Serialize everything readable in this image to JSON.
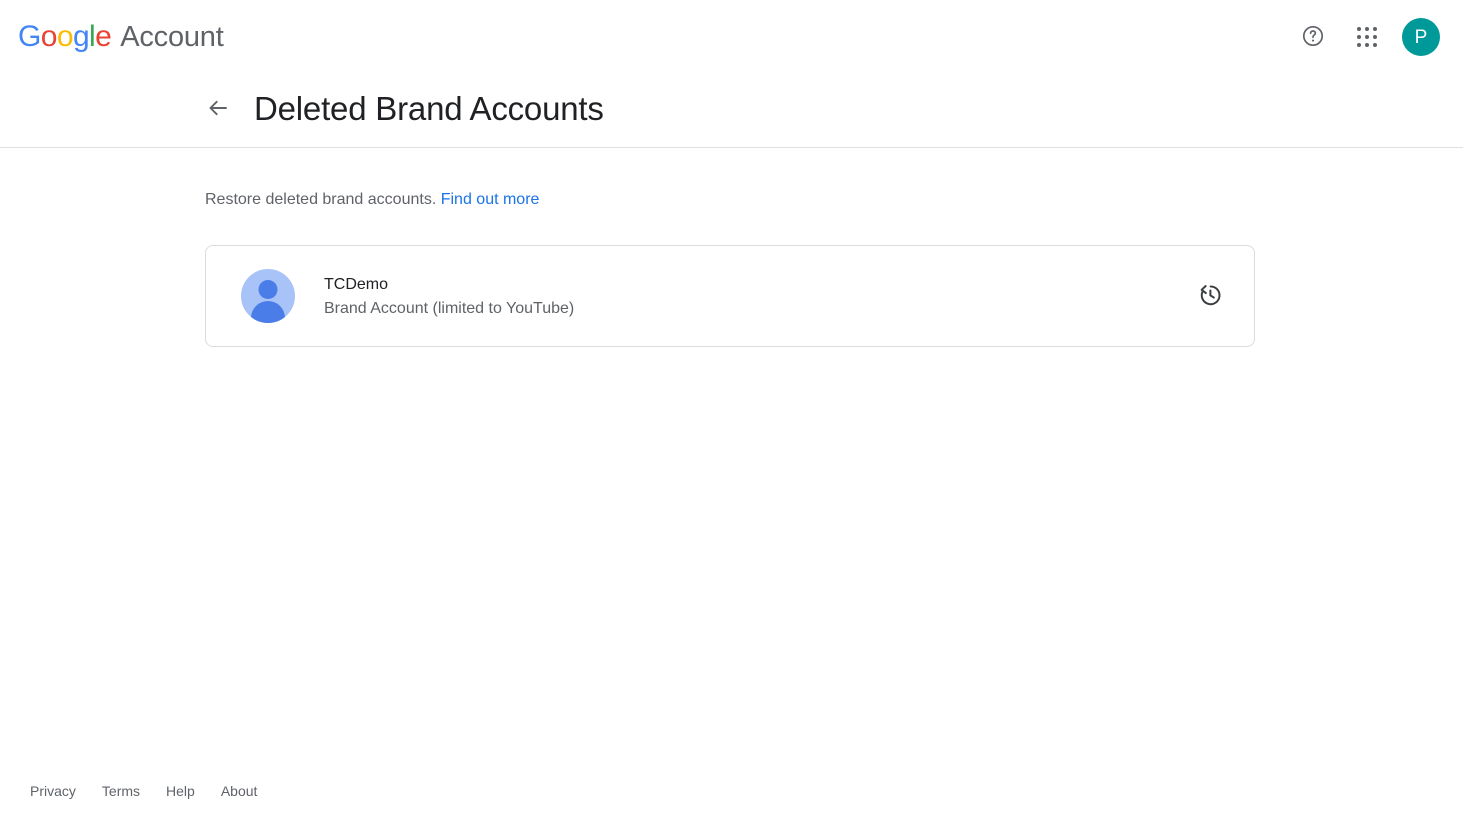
{
  "header": {
    "logo_letters": [
      "G",
      "o",
      "o",
      "g",
      "l",
      "e"
    ],
    "product_name": "Account",
    "help_icon": "help-circle-icon",
    "apps_icon": "apps-grid-icon",
    "avatar_initial": "P",
    "avatar_color": "#009999"
  },
  "title_bar": {
    "back_icon": "arrow-left-icon",
    "title": "Deleted Brand Accounts"
  },
  "main": {
    "description_text": "Restore deleted brand accounts.",
    "description_link": "Find out more",
    "accounts": [
      {
        "name": "TCDemo",
        "type": "Brand Account (limited to YouTube)",
        "avatar_icon": "default-person-avatar-icon",
        "restore_icon": "restore-history-icon"
      }
    ]
  },
  "footer": {
    "links": [
      "Privacy",
      "Terms",
      "Help",
      "About"
    ]
  },
  "colors": {
    "link_blue": "#1a73e8",
    "text_primary": "#202124",
    "text_secondary": "#5f6368",
    "border": "#dadce0",
    "divider": "#e0e0e0",
    "avatar_bg": "#a8c3f7",
    "avatar_fg": "#4a7de8"
  }
}
